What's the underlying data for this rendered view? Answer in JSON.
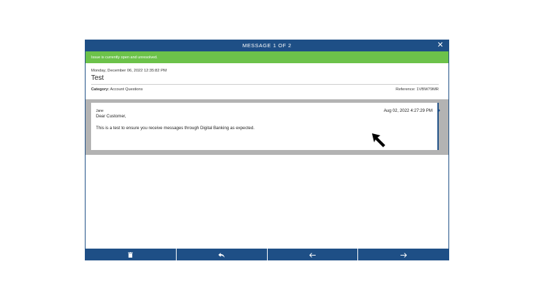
{
  "dialog": {
    "title": "MESSAGE 1 OF 2",
    "close_icon": "close-icon"
  },
  "status": {
    "text": "Issue is currently open and unresolved."
  },
  "message": {
    "date": "Monday, December 06, 2022 12:35:82 PM",
    "subject": "Test",
    "category_label": "Category:",
    "category_value": "Account Questions",
    "reference": "Reference: 1VBW79MR"
  },
  "thread": {
    "sender": "Jane",
    "timestamp": "Aug 02, 2022 4:27:29 PM",
    "greeting": "Dear Customer,",
    "body": "This is a test to ensure you receive messages through Digital Banking as expected."
  },
  "toolbar": {
    "buttons": [
      {
        "icon": "trash-icon"
      },
      {
        "icon": "reply-icon"
      },
      {
        "icon": "arrow-left-icon"
      },
      {
        "icon": "arrow-right-icon"
      }
    ]
  },
  "colors": {
    "primary": "#1e4f86",
    "status": "#6cc24a",
    "thread_bg": "#b3b3b3"
  }
}
